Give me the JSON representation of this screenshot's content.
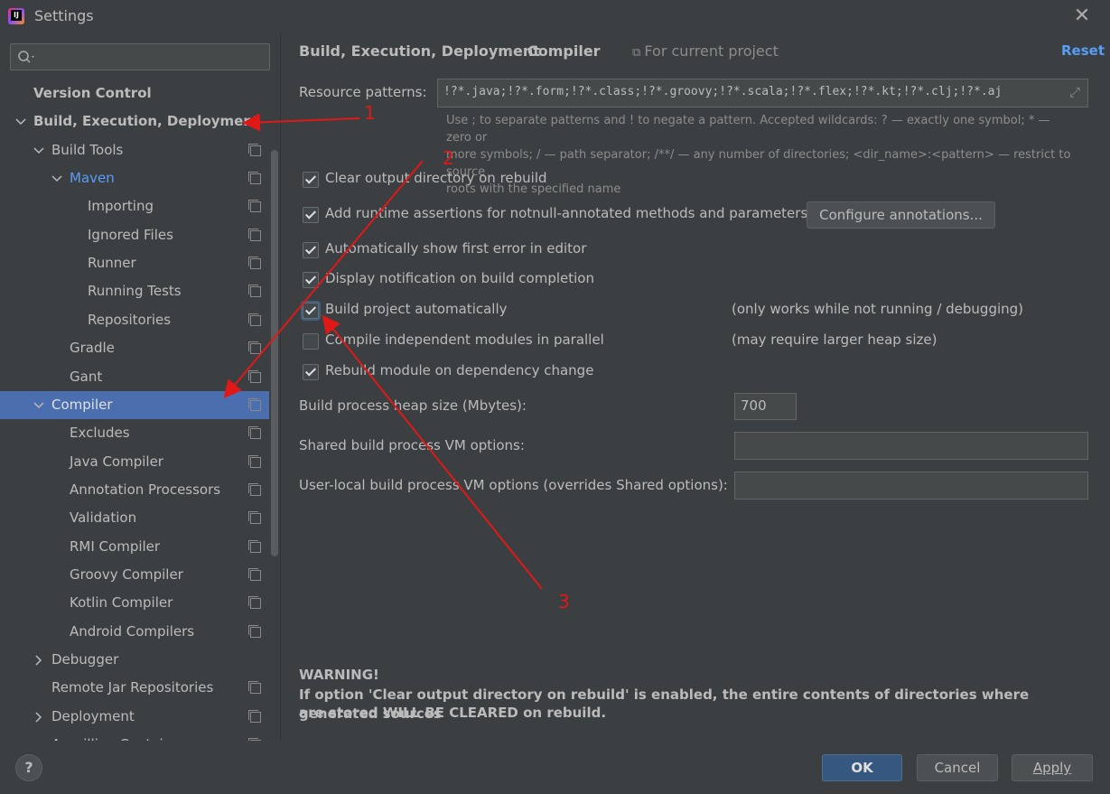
{
  "window": {
    "title": "Settings"
  },
  "search": {
    "placeholder": ""
  },
  "tree": [
    {
      "label": "Version Control",
      "level": 0,
      "expanded": null,
      "bold": true
    },
    {
      "label": "Build, Execution, Deployment",
      "level": 0,
      "expanded": true,
      "bold": true
    },
    {
      "label": "Build Tools",
      "level": 1,
      "expanded": true,
      "project": true
    },
    {
      "label": "Maven",
      "level": 2,
      "expanded": true,
      "project": true,
      "highlight": true
    },
    {
      "label": "Importing",
      "level": 3,
      "project": true
    },
    {
      "label": "Ignored Files",
      "level": 3,
      "project": true
    },
    {
      "label": "Runner",
      "level": 3,
      "project": true
    },
    {
      "label": "Running Tests",
      "level": 3,
      "project": true
    },
    {
      "label": "Repositories",
      "level": 3,
      "project": true
    },
    {
      "label": "Gradle",
      "level": 2,
      "project": true
    },
    {
      "label": "Gant",
      "level": 2,
      "project": true
    },
    {
      "label": "Compiler",
      "level": 1,
      "expanded": true,
      "project": true,
      "selected": true
    },
    {
      "label": "Excludes",
      "level": 2,
      "project": true
    },
    {
      "label": "Java Compiler",
      "level": 2,
      "project": true
    },
    {
      "label": "Annotation Processors",
      "level": 2,
      "project": true
    },
    {
      "label": "Validation",
      "level": 2,
      "project": true
    },
    {
      "label": "RMI Compiler",
      "level": 2,
      "project": true
    },
    {
      "label": "Groovy Compiler",
      "level": 2,
      "project": true
    },
    {
      "label": "Kotlin Compiler",
      "level": 2,
      "project": true
    },
    {
      "label": "Android Compilers",
      "level": 2,
      "project": true
    },
    {
      "label": "Debugger",
      "level": 1,
      "expanded": false
    },
    {
      "label": "Remote Jar Repositories",
      "level": 1,
      "project": true
    },
    {
      "label": "Deployment",
      "level": 1,
      "expanded": false,
      "project": true
    },
    {
      "label": "Arquillian Containers",
      "level": 1,
      "project": true
    }
  ],
  "header": {
    "crumb1": "Build, Execution, Deployment",
    "sep": "›",
    "crumb2": "Compiler",
    "scope": "For current project",
    "reset": "Reset"
  },
  "resource": {
    "label": "Resource patterns:",
    "value": "!?*.java;!?*.form;!?*.class;!?*.groovy;!?*.scala;!?*.flex;!?*.kt;!?*.clj;!?*.aj",
    "hint1": "Use ; to separate patterns and ! to negate a pattern. Accepted wildcards: ? — exactly one symbol; * — zero or",
    "hint2": "more symbols; / — path separator; /**/ — any number of directories; <dir_name>:<pattern> — restrict to source",
    "hint3": "roots with the specified name"
  },
  "options": [
    {
      "label": "Clear output directory on rebuild",
      "checked": true
    },
    {
      "label": "Add runtime assertions for notnull-annotated methods and parameters",
      "checked": true
    },
    {
      "label": "Automatically show first error in editor",
      "checked": true
    },
    {
      "label": "Display notification on build completion",
      "checked": true
    },
    {
      "label": "Build project automatically",
      "checked": true,
      "note": "(only works while not running / debugging)"
    },
    {
      "label": "Compile independent modules in parallel",
      "checked": false,
      "note": "(may require larger heap size)"
    },
    {
      "label": "Rebuild module on dependency change",
      "checked": true
    }
  ],
  "configure_button": "Configure annotations...",
  "heap": {
    "label": "Build process heap size (Mbytes):",
    "value": "700"
  },
  "shared_vm": {
    "label": "Shared build process VM options:",
    "value": ""
  },
  "local_vm": {
    "label": "User-local build process VM options (overrides Shared options):",
    "value": ""
  },
  "warning": {
    "title": "WARNING!",
    "line1": "If option 'Clear output directory on rebuild' is enabled, the entire contents of directories where generated sources",
    "line2": "are stored WILL BE CLEARED on rebuild."
  },
  "footer": {
    "help": "?",
    "ok": "OK",
    "cancel": "Cancel",
    "apply": "Apply"
  },
  "annotations": [
    "1",
    "2",
    "3"
  ],
  "colors": {
    "selection": "#4b6eaf",
    "link": "#589df6",
    "annotation": "#e01818"
  }
}
